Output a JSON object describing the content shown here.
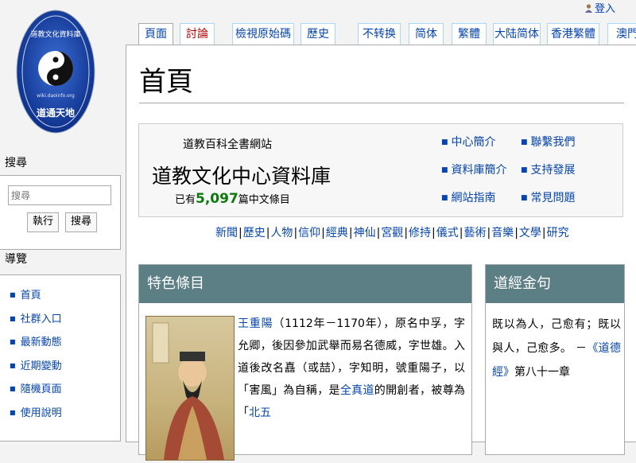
{
  "logo": {
    "site_name": "道通天地",
    "ring_text": "道教文化資料庫",
    "domain": "wiki.daoinfo.org"
  },
  "personal": {
    "login_label": "登入"
  },
  "tabs": [
    {
      "label": "頁面",
      "selected": true
    },
    {
      "label": "討論",
      "red": true
    },
    {
      "label": "檢視原始碼"
    },
    {
      "label": "歷史"
    },
    {
      "label": "不转换"
    },
    {
      "label": "简体"
    },
    {
      "label": "繁體"
    },
    {
      "label": "大陆简体"
    },
    {
      "label": "香港繁體"
    },
    {
      "label": "澳門"
    }
  ],
  "page": {
    "title": "首頁"
  },
  "intro": {
    "subtitle": "道教百科全書網站",
    "main_title": "道教文化中心資料庫",
    "count_prefix": "已有",
    "count_value": "5,097",
    "count_suffix": "篇中文條目",
    "links": [
      "中心簡介",
      "聯繫我們",
      "資料庫簡介",
      "支持發展",
      "網站指南",
      "常見問題"
    ]
  },
  "categories": [
    "新聞",
    "歷史",
    "人物",
    "信仰",
    "經典",
    "神仙",
    "宮觀",
    "修持",
    "儀式",
    "藝術",
    "音樂",
    "文學",
    "研究"
  ],
  "featured": {
    "header": "特色條目",
    "name_link": "王重陽",
    "text_1": "（1112年－1170年），原名中孚，字允卿，後因參加武舉而易名德威，字世雄。入道後改名嚞（或喆），字知明，號重陽子，以「害風」為自稱，是",
    "link_2": "全真道",
    "text_2": "的開創者，被尊為「",
    "link_3": "北五"
  },
  "quote": {
    "header": "道經金句",
    "text": "既以為人，己愈有；既以與人，己愈多。 －",
    "source_link": "《道德經》",
    "source_suffix": "第八十一章"
  },
  "sidebar": {
    "search_title": "搜尋",
    "search_placeholder": "搜尋",
    "go_button": "執行",
    "search_button": "搜尋",
    "nav_title": "導覽",
    "nav_items": [
      "首頁",
      "社群入口",
      "最新動態",
      "近期變動",
      "隨機頁面",
      "使用說明"
    ]
  },
  "colors": {
    "box_header": "#5b7f84",
    "link": "#0645ad",
    "count_green": "#0b7a0b"
  }
}
